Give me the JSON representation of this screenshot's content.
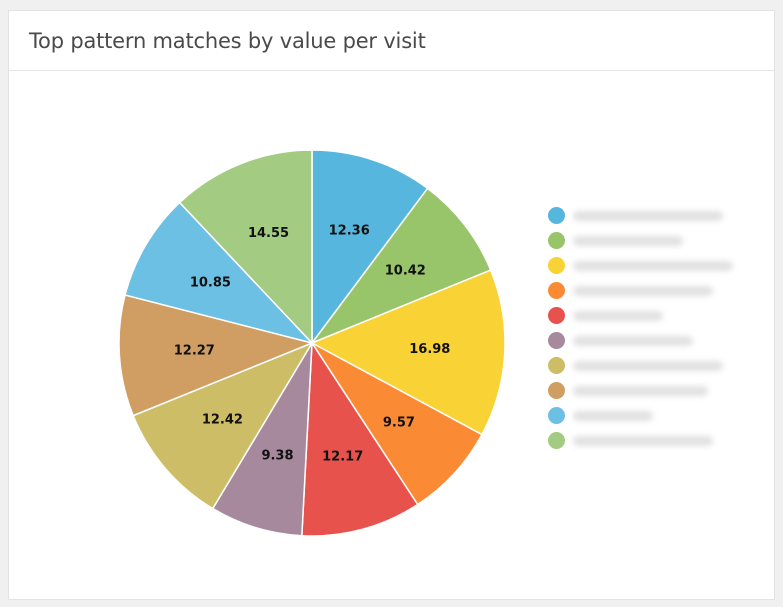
{
  "card": {
    "title": "Top pattern matches by value per visit"
  },
  "chart_data": {
    "type": "pie",
    "title": "Top pattern matches by value per visit",
    "start_angle": "12 o'clock",
    "direction": "clockwise",
    "legend_position": "right",
    "legend_labels_obscured": true,
    "slices": [
      {
        "value": 12.36,
        "color": "#57b6de"
      },
      {
        "value": 10.42,
        "color": "#98c46a"
      },
      {
        "value": 16.98,
        "color": "#f9d235"
      },
      {
        "value": 9.57,
        "color": "#fa8b34"
      },
      {
        "value": 12.17,
        "color": "#e8524d"
      },
      {
        "value": 9.38,
        "color": "#a7899e"
      },
      {
        "value": 12.42,
        "color": "#ccbd66"
      },
      {
        "value": 12.27,
        "color": "#d09e62"
      },
      {
        "value": 10.85,
        "color": "#6cc0e4"
      },
      {
        "value": 14.55,
        "color": "#a3cb82"
      }
    ]
  }
}
